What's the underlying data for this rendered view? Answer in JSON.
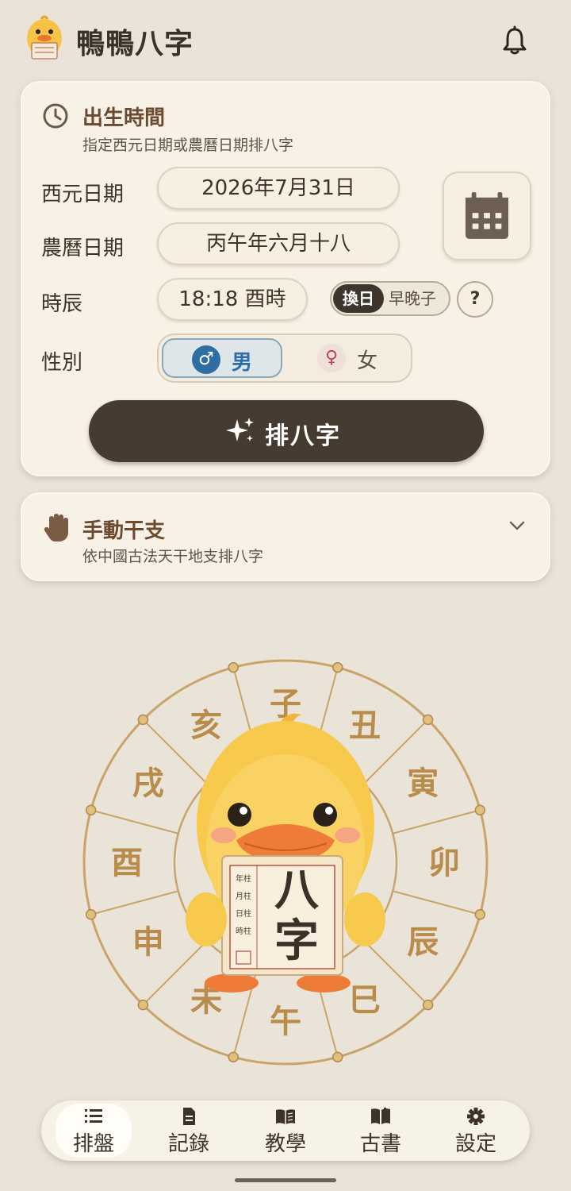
{
  "app": {
    "title": "鴨鴨八字"
  },
  "birth_card": {
    "title": "出生時間",
    "subtitle": "指定西元日期或農曆日期排八字",
    "solar_label": "西元日期",
    "solar_value": "2026年7月31日",
    "lunar_label": "農曆日期",
    "lunar_value": "丙午年六月十八",
    "hour_label": "時辰",
    "hour_value": "18:18 酉時",
    "swap_on": "換日",
    "swap_off": "早晚子",
    "help": "?",
    "gender_label": "性別",
    "male": "男",
    "female": "女",
    "submit": "排八字"
  },
  "manual_card": {
    "title": "手動干支",
    "subtitle": "依中國古法天干地支排八字"
  },
  "illustration": {
    "branches": [
      "子",
      "丑",
      "寅",
      "卯",
      "辰",
      "巳",
      "午",
      "未",
      "申",
      "酉",
      "戌",
      "亥"
    ],
    "sign_big": [
      "八",
      "字"
    ],
    "sign_small": [
      "年柱",
      "月柱",
      "日柱",
      "時柱"
    ]
  },
  "nav": {
    "items": [
      {
        "label": "排盤",
        "icon": "list-icon"
      },
      {
        "label": "記錄",
        "icon": "document-icon"
      },
      {
        "label": "教學",
        "icon": "open-book-icon"
      },
      {
        "label": "古書",
        "icon": "book-icon"
      },
      {
        "label": "設定",
        "icon": "gear-icon"
      }
    ],
    "active_index": 0
  },
  "colors": {
    "background": "#e9e3d8",
    "card": "#f8f2e6",
    "primary": "#453b30",
    "accent_brown": "#6b4a2f",
    "wheel_gold": "#c9a46a",
    "male_blue": "#2f6ea3",
    "female_red": "#b8475c"
  }
}
